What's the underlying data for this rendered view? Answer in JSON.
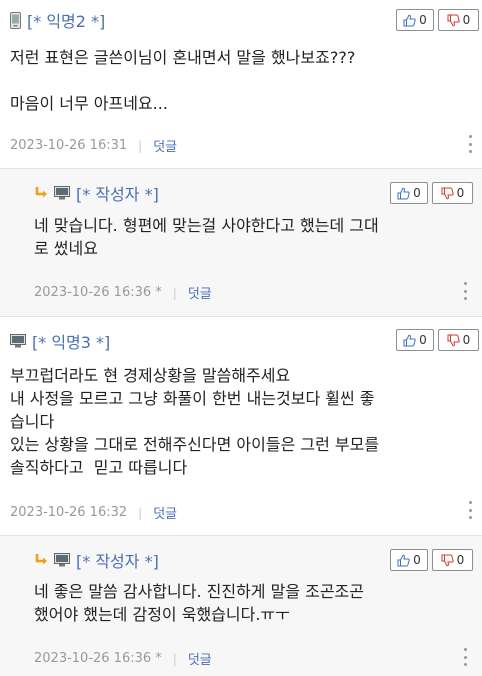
{
  "comments": [
    {
      "author": "[* 익명2 *]",
      "device_icon": "mobile-phone-icon",
      "up_count": "0",
      "down_count": "0",
      "text": "저런 표현은 글쓴이님이 혼내면서 말을 했나보죠???\n\n마음이 너무 아프네요...",
      "datetime": "2023-10-26 16:31",
      "reply_label": "덧글"
    },
    {
      "author": "[* 작성자 *]",
      "device_icon": "desktop-pc-icon",
      "up_count": "0",
      "down_count": "0",
      "text": "네 맞습니다. 형편에 맞는걸 사야한다고 했는데 그대\n로 썼네요",
      "datetime": "2023-10-26 16:36 *",
      "reply_label": "덧글"
    },
    {
      "author": "[* 익명3 *]",
      "device_icon": "desktop-pc-icon",
      "up_count": "0",
      "down_count": "0",
      "text": "부끄럽더라도 현 경제상황을 말씀해주세요\n내 사정을 모르고 그냥 화풀이 한번 내는것보다 휠씬 좋\n습니다\n있는 상황을 그대로 전해주신다면 아이들은 그런 부모를\n솔직하다고  믿고 따릅니다",
      "datetime": "2023-10-26 16:32",
      "reply_label": "덧글"
    },
    {
      "author": "[* 작성자 *]",
      "device_icon": "desktop-pc-icon",
      "up_count": "0",
      "down_count": "0",
      "text": "네 좋은 말씀 감사합니다. 진진하게 말을 조곤조곤\n했어야 했는데 감정이 욱했습니다.ㅠㅜ",
      "datetime": "2023-10-26 16:36 *",
      "reply_label": "덧글"
    }
  ],
  "colors": {
    "author": "#4a6fb5",
    "reply_link": "#4a6fb5",
    "meta": "#999999",
    "reply_bg": "#f7f7f7",
    "thumb_up": "#3b6fc4",
    "thumb_down": "#d0342c",
    "reply_arrow": "#f0a020"
  }
}
